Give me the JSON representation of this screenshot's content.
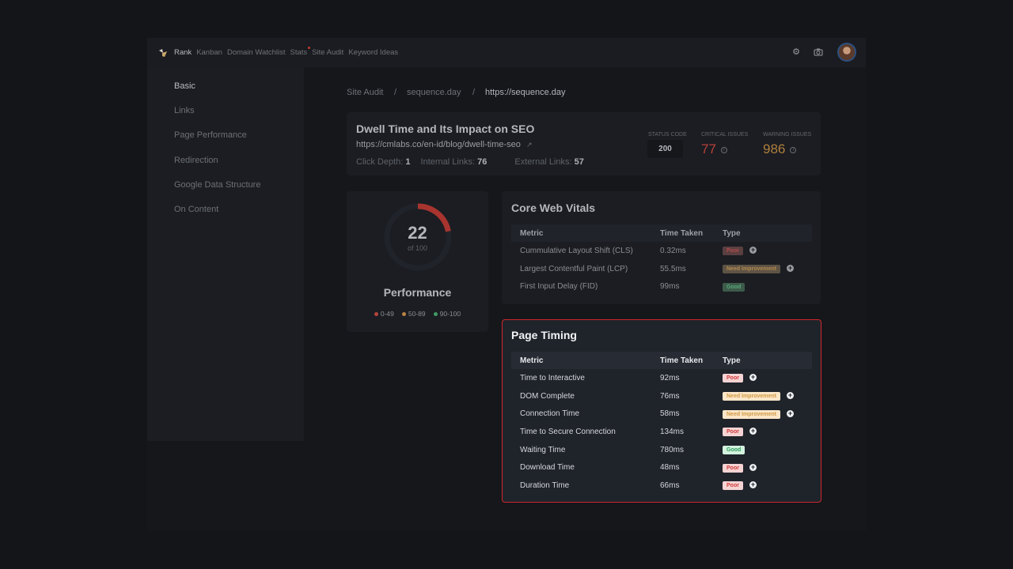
{
  "nav": {
    "items": [
      {
        "label": "Rank",
        "active": true
      },
      {
        "label": "Kanban"
      },
      {
        "label": "Domain Watchlist"
      },
      {
        "label": "Stats",
        "dot": true
      },
      {
        "label": "Site Audit"
      },
      {
        "label": "Keyword Ideas"
      }
    ],
    "icons": [
      "settings-icon",
      "camera-icon",
      "avatar"
    ]
  },
  "sidebar": {
    "items": [
      "Basic",
      "Links",
      "Page Performance",
      "Redirection",
      "Google Data Structure",
      "On Content"
    ],
    "active": 0
  },
  "breadcrumb": [
    "Site Audit",
    "sequence.day",
    "https://sequence.day"
  ],
  "page": {
    "title": "Dwell Time and Its Impact on SEO",
    "url": "https://cmlabs.co/en-id/blog/dwell-time-seo",
    "click_depth_label": "Click Depth:",
    "click_depth": "1",
    "internal_label": "Internal Links:",
    "internal": "76",
    "external_label": "External Links:",
    "external": "57",
    "status_label": "STATUS CODE",
    "status": "200",
    "critical_label": "CRITICAL ISSUES",
    "critical": "77",
    "warning_label": "WARNING ISSUES",
    "warning": "986"
  },
  "performance": {
    "score": 22,
    "score_text": "22",
    "of_text": "of 100",
    "label": "Performance",
    "legend": [
      {
        "label": "0-49",
        "color": "#b8443d"
      },
      {
        "label": "50-89",
        "color": "#b98344"
      },
      {
        "label": "90-100",
        "color": "#3f9a63"
      }
    ]
  },
  "colors": {
    "critical": "#b8403a",
    "warning": "#b07f3c",
    "highlight_border": "#d0262e"
  },
  "cwv": {
    "title": "Core Web Vitals",
    "headers": [
      "Metric",
      "Time Taken",
      "Type"
    ],
    "rows": [
      [
        "Cummulative Layout Shift (CLS)",
        "0.32ms",
        "Poor"
      ],
      [
        "Largest Contentful Paint (LCP)",
        "55.5ms",
        "Need Improvement"
      ],
      [
        "First Input Delay (FID)",
        "99ms",
        "Good"
      ]
    ]
  },
  "timing": {
    "title": "Page Timing",
    "headers": [
      "Metric",
      "Time Taken",
      "Type"
    ],
    "rows": [
      [
        "Time to Interactive",
        "92ms",
        "Poor"
      ],
      [
        "DOM Complete",
        "76ms",
        "Need Improvement"
      ],
      [
        "Connection Time",
        "58ms",
        "Need Improvement"
      ],
      [
        "Time to Secure Connection",
        "134ms",
        "Poor"
      ],
      [
        "Waiting Time",
        "780ms",
        "Good"
      ],
      [
        "Download Time",
        "48ms",
        "Poor"
      ],
      [
        "Duration Time",
        "66ms",
        "Poor"
      ]
    ]
  }
}
